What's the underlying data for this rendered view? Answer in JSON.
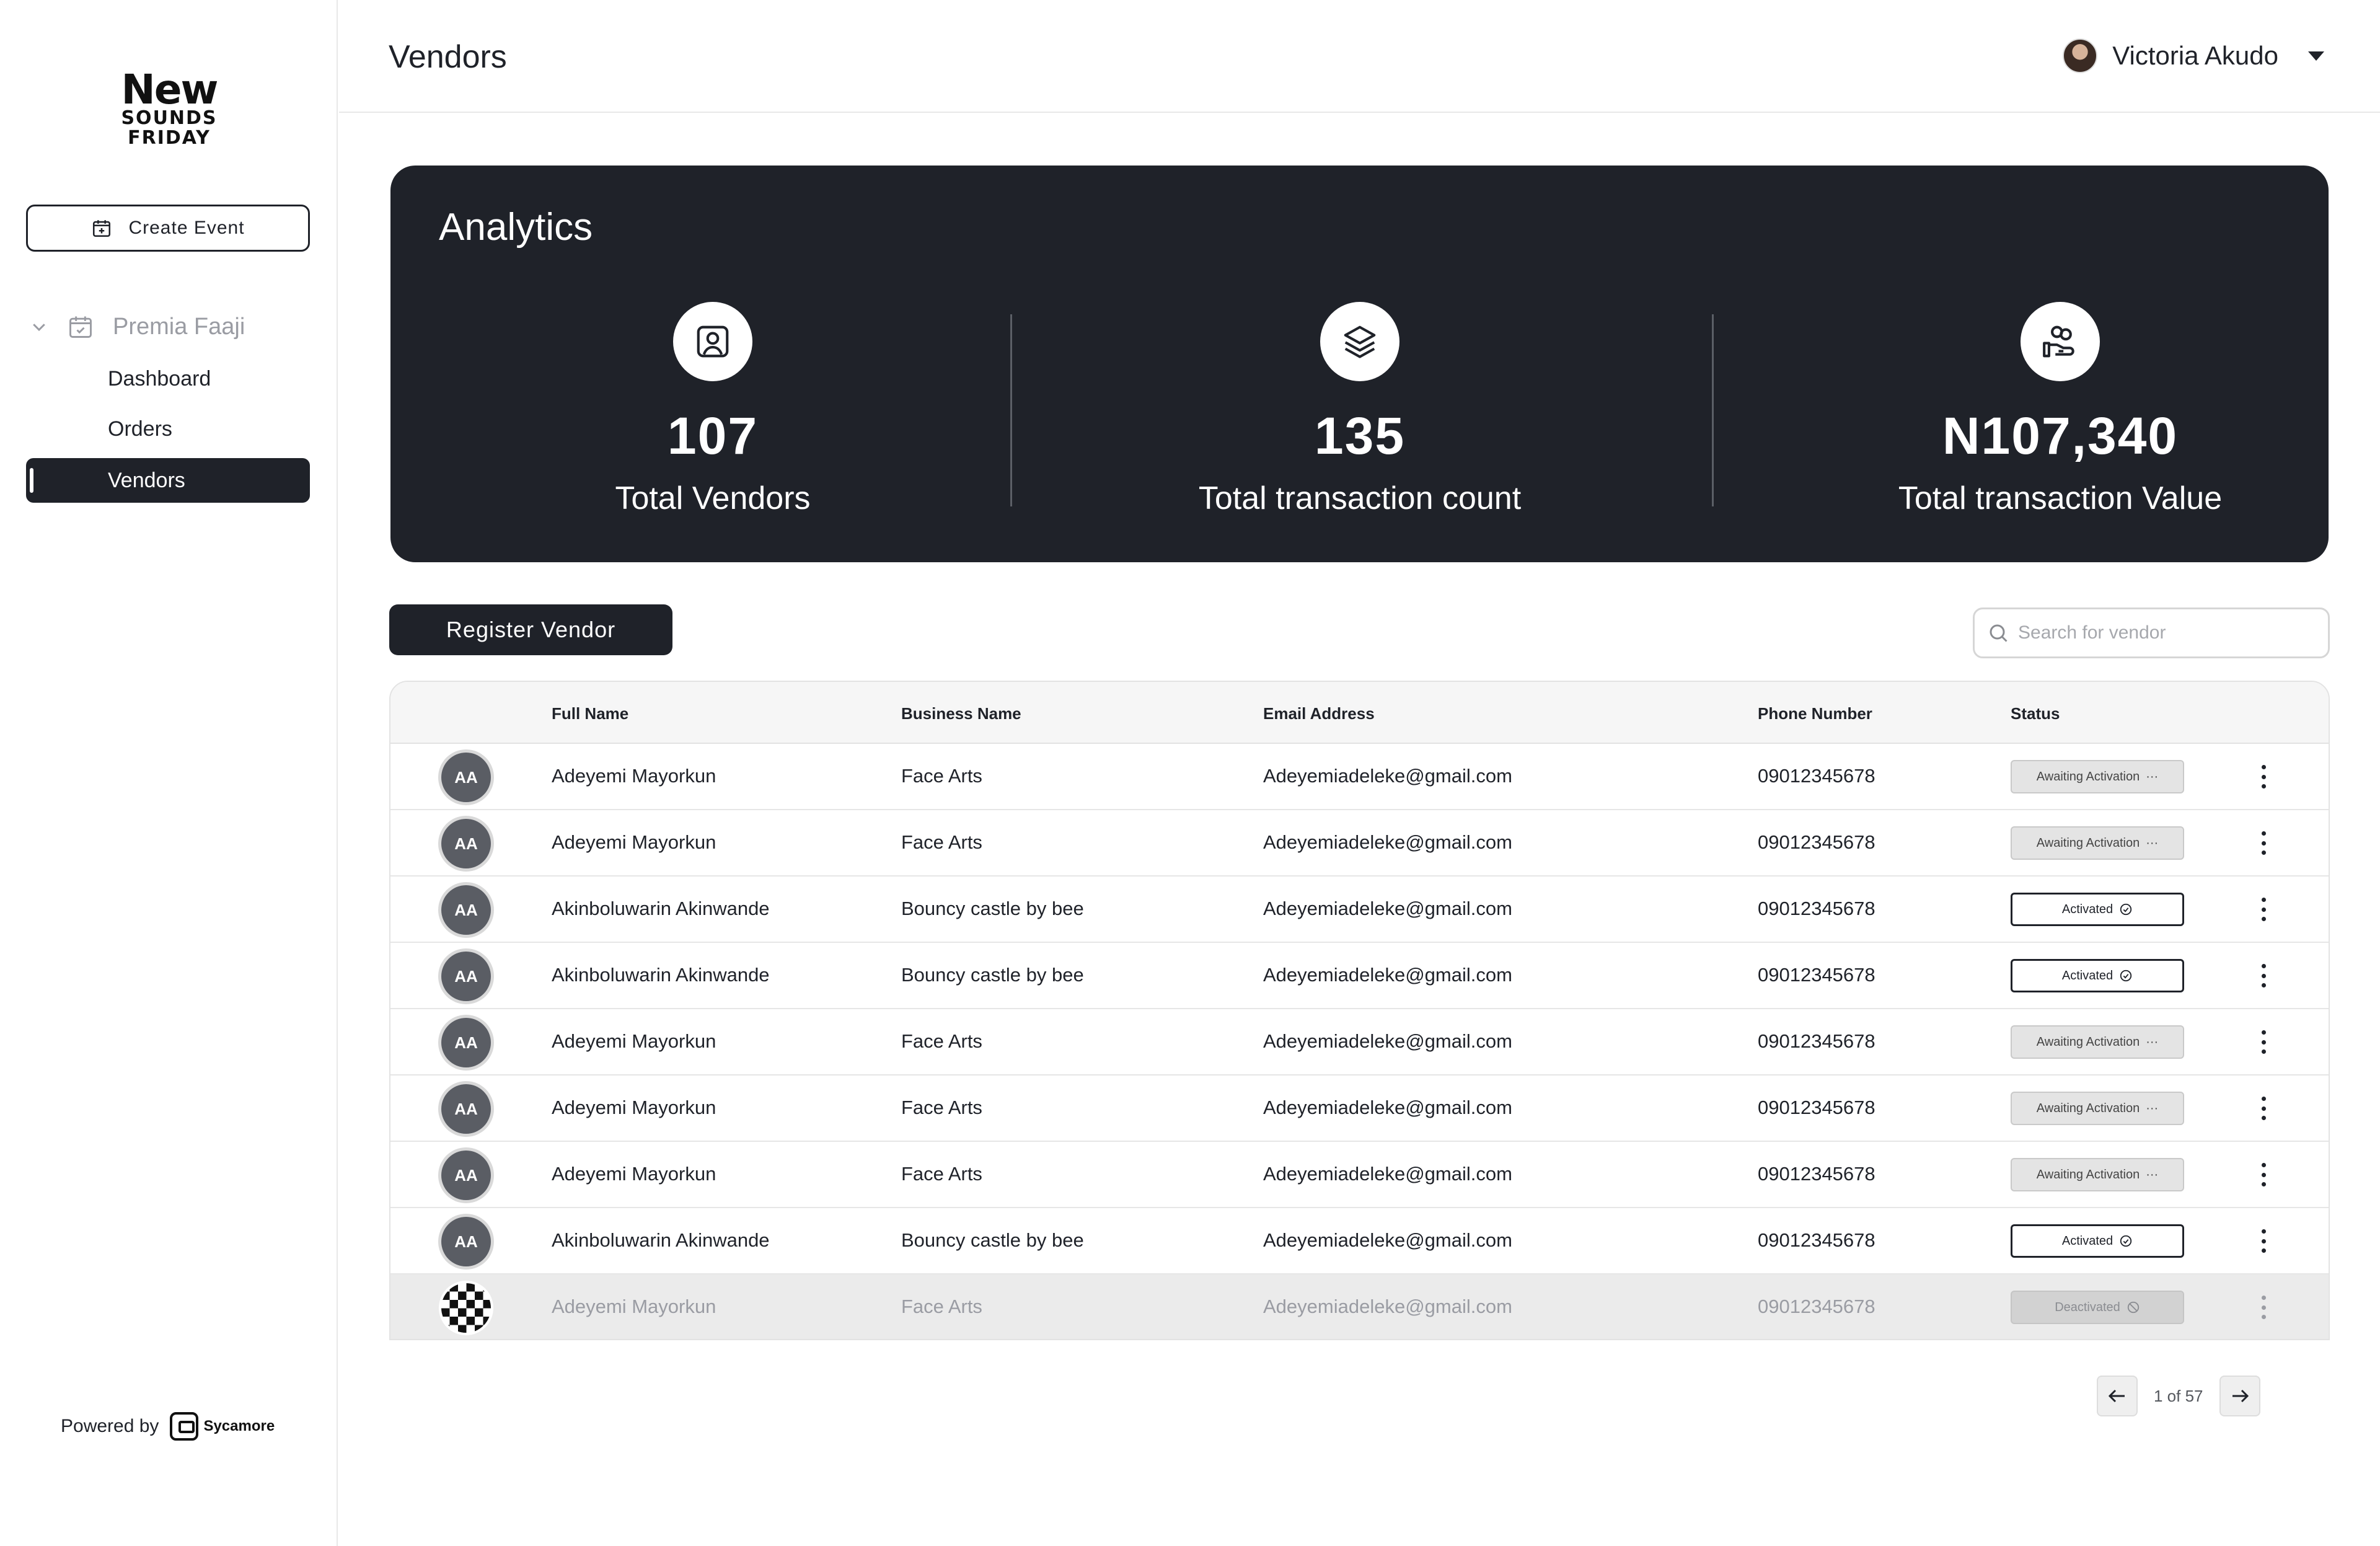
{
  "brand": {
    "logo_line1": "New",
    "logo_line2": "SOUNDS",
    "logo_line3": "FRIDAY"
  },
  "sidebar": {
    "create_event_label": "Create Event",
    "event_group": "Premia Faaji",
    "items": [
      {
        "label": "Dashboard"
      },
      {
        "label": "Orders"
      },
      {
        "label": "Vendors",
        "active": true
      }
    ],
    "powered_by": "Powered by",
    "powered_brand": "Sycamore"
  },
  "header": {
    "title": "Vendors",
    "user_name": "Victoria Akudo"
  },
  "analytics": {
    "title": "Analytics",
    "stats": [
      {
        "value": "107",
        "label": "Total Vendors",
        "icon": "user-badge-icon"
      },
      {
        "value": "135",
        "label": "Total transaction count",
        "icon": "layers-icon"
      },
      {
        "value": "N107,340",
        "label": "Total transaction Value",
        "icon": "hand-coins-icon"
      }
    ]
  },
  "toolbar": {
    "register_label": "Register Vendor",
    "search_placeholder": "Search for vendor"
  },
  "table": {
    "columns": [
      "Full Name",
      "Business Name",
      "Email Address",
      "Phone  Number",
      "Status"
    ],
    "rows": [
      {
        "initials": "AA",
        "name": "Adeyemi Mayorkun",
        "business": "Face Arts",
        "email": "Adeyemiadeleke@gmail.com",
        "phone": "09012345678",
        "status": "Awaiting Activation"
      },
      {
        "initials": "AA",
        "name": "Adeyemi Mayorkun",
        "business": "Face Arts",
        "email": "Adeyemiadeleke@gmail.com",
        "phone": "09012345678",
        "status": "Awaiting Activation"
      },
      {
        "initials": "AA",
        "name": "Akinboluwarin Akinwande",
        "business": "Bouncy castle by bee",
        "email": "Adeyemiadeleke@gmail.com",
        "phone": "09012345678",
        "status": "Activated"
      },
      {
        "initials": "AA",
        "name": "Akinboluwarin Akinwande",
        "business": "Bouncy castle by bee",
        "email": "Adeyemiadeleke@gmail.com",
        "phone": "09012345678",
        "status": "Activated"
      },
      {
        "initials": "AA",
        "name": "Adeyemi Mayorkun",
        "business": "Face Arts",
        "email": "Adeyemiadeleke@gmail.com",
        "phone": "09012345678",
        "status": "Awaiting Activation"
      },
      {
        "initials": "AA",
        "name": "Adeyemi Mayorkun",
        "business": "Face Arts",
        "email": "Adeyemiadeleke@gmail.com",
        "phone": "09012345678",
        "status": "Awaiting Activation"
      },
      {
        "initials": "AA",
        "name": "Adeyemi Mayorkun",
        "business": "Face Arts",
        "email": "Adeyemiadeleke@gmail.com",
        "phone": "09012345678",
        "status": "Awaiting Activation"
      },
      {
        "initials": "AA",
        "name": "Akinboluwarin Akinwande",
        "business": "Bouncy castle by bee",
        "email": "Adeyemiadeleke@gmail.com",
        "phone": "09012345678",
        "status": "Activated"
      },
      {
        "initials": "",
        "name": "Adeyemi Mayorkun",
        "business": "Face Arts",
        "email": "Adeyemiadeleke@gmail.com",
        "phone": "09012345678",
        "status": "Deactivated"
      }
    ]
  },
  "pagination": {
    "label": "1 of 57"
  }
}
